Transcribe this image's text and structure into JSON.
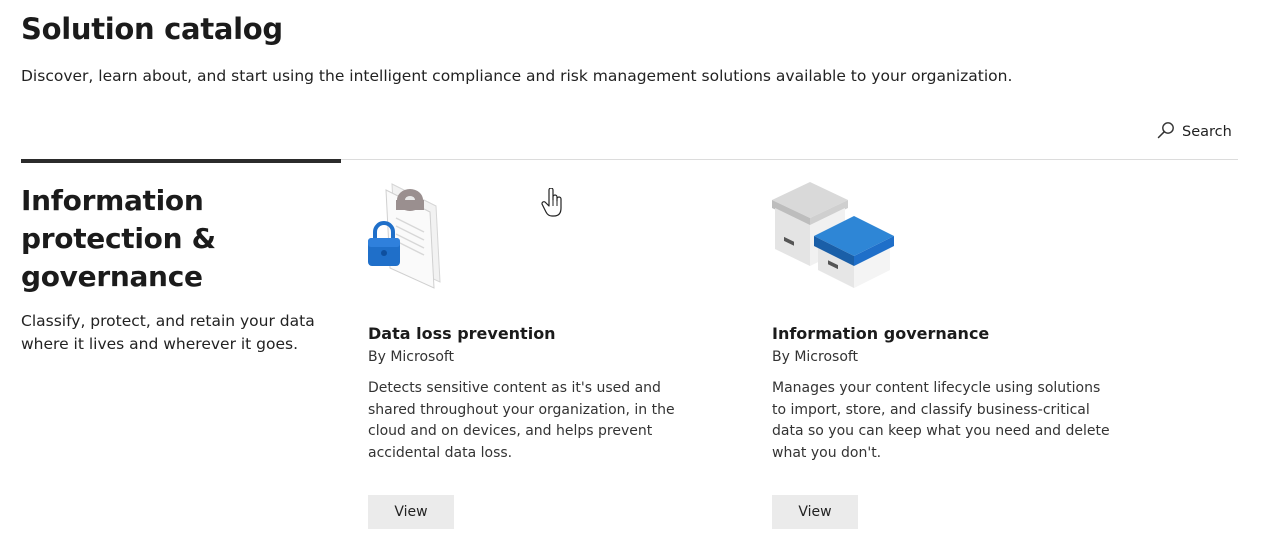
{
  "header": {
    "title": "Solution catalog",
    "description": "Discover, learn about, and start using the intelligent compliance and risk management solutions available to your organization."
  },
  "search": {
    "label": "Search",
    "icon": "search-icon"
  },
  "section": {
    "title": "Information protection & governance",
    "description": "Classify, protect, and retain your data where it lives and wherever it goes."
  },
  "cards": [
    {
      "title": "Data loss prevention",
      "vendor": "By Microsoft",
      "description": "Detects sensitive content as it's used and shared throughout your organization, in the cloud and on devices, and helps prevent accidental data loss.",
      "button": "View",
      "icon": "document-lock-icon"
    },
    {
      "title": "Information governance",
      "vendor": "By Microsoft",
      "description": "Manages your content lifecycle using solutions to import, store, and classify business-critical data so you can keep what you need and delete what you don't.",
      "button": "View",
      "icon": "archive-boxes-icon"
    }
  ],
  "colors": {
    "accent_blue": "#1f6fc9",
    "tab_underline": "#2b2b2b",
    "button_bg": "#ebebeb"
  }
}
